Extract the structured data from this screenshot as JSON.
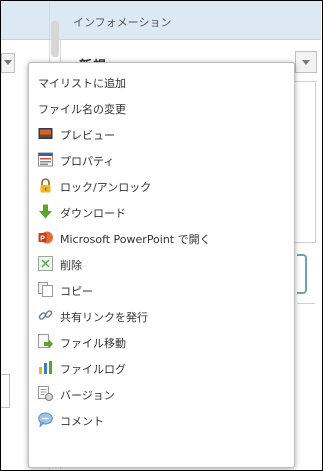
{
  "info_panel": {
    "header_title": "インフォメーション",
    "field_value": "新規"
  },
  "context_menu": {
    "items": [
      {
        "label": "マイリストに追加",
        "icon": null
      },
      {
        "label": "ファイル名の変更",
        "icon": null
      },
      {
        "label": "プレビュー",
        "icon": "preview-icon"
      },
      {
        "label": "プロパティ",
        "icon": "properties-icon"
      },
      {
        "label": "ロック/アンロック",
        "icon": "lock-icon"
      },
      {
        "label": "ダウンロード",
        "icon": "download-icon"
      },
      {
        "label": "Microsoft PowerPoint で開く",
        "icon": "powerpoint-icon"
      },
      {
        "label": "削除",
        "icon": "delete-icon"
      },
      {
        "label": "コピー",
        "icon": "copy-icon"
      },
      {
        "label": "共有リンクを発行",
        "icon": "link-icon"
      },
      {
        "label": "ファイル移動",
        "icon": "move-file-icon"
      },
      {
        "label": "ファイルログ",
        "icon": "file-log-icon"
      },
      {
        "label": "バージョン",
        "icon": "version-icon"
      },
      {
        "label": "コメント",
        "icon": "comment-icon"
      }
    ]
  },
  "colors": {
    "header_bg": "#dce8f4",
    "menu_border": "#bdbdbd",
    "accent_blue": "#6aa0c8"
  }
}
